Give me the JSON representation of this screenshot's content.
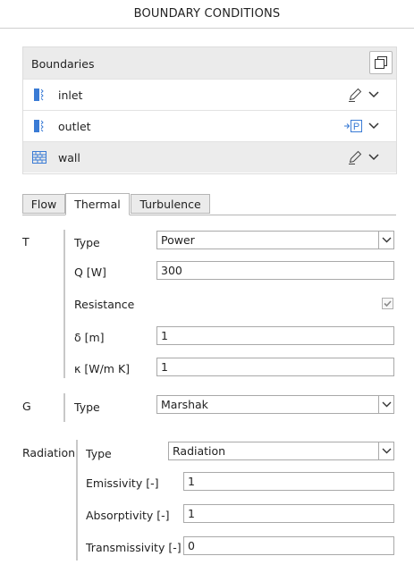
{
  "header": {
    "title": "BOUNDARY CONDITIONS"
  },
  "boundaries": {
    "title": "Boundaries",
    "items": [
      {
        "label": "inlet",
        "action_icon": "edit-icon"
      },
      {
        "label": "outlet",
        "action_icon": "parameter-p-icon",
        "action_text": "P"
      },
      {
        "label": "wall",
        "action_icon": "edit-icon",
        "selected": true
      }
    ]
  },
  "tabs": [
    {
      "label": "Flow"
    },
    {
      "label": "Thermal",
      "active": true
    },
    {
      "label": "Turbulence"
    }
  ],
  "sections": {
    "t": {
      "label": "T",
      "type_label": "Type",
      "type_value": "Power",
      "q_label": "Q [W]",
      "q_value": "300",
      "resistance_label": "Resistance",
      "resistance_checked": true,
      "delta_label": "δ [m]",
      "delta_value": "1",
      "kappa_label": "κ [W/m K]",
      "kappa_value": "1"
    },
    "g": {
      "label": "G",
      "type_label": "Type",
      "type_value": "Marshak"
    },
    "radiation": {
      "label": "Radiation",
      "type_label": "Type",
      "type_value": "Radiation",
      "emissivity_label": "Emissivity [-]",
      "emissivity_value": "1",
      "absorptivity_label": "Absorptivity [-]",
      "absorptivity_value": "1",
      "transmissivity_label": "Transmissivity [-]",
      "transmissivity_value": "0"
    }
  },
  "colors": {
    "accent": "#3a7bd5",
    "selected_row": "#ececec",
    "header_bg": "#ebebeb"
  }
}
